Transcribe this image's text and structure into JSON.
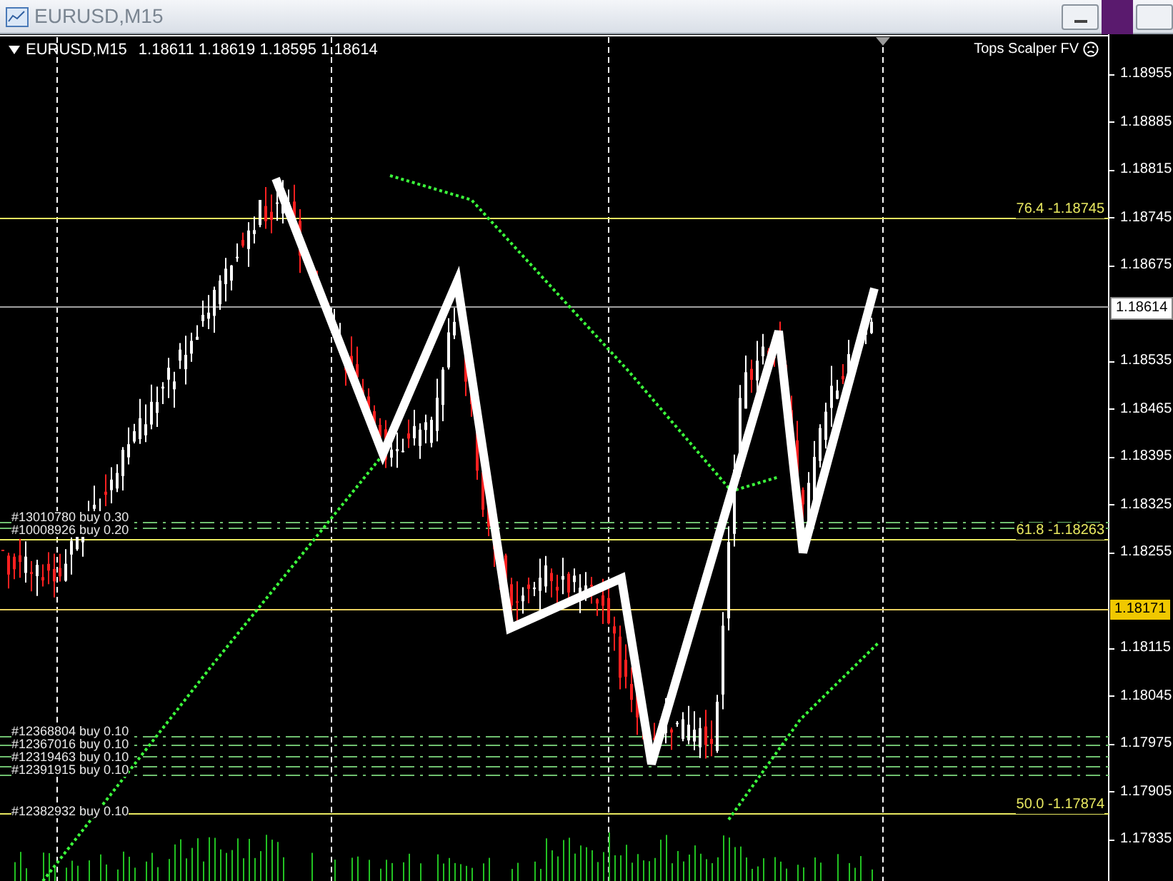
{
  "window": {
    "title": "EURUSD,M15"
  },
  "chart": {
    "symbol": "EURUSD,M15",
    "ohlc": [
      "1.18611",
      "1.18619",
      "1.18595",
      "1.18614"
    ],
    "indicator": "Tops Scalper FV",
    "price_axis": [
      "1.18955",
      "1.18885",
      "1.18815",
      "1.18745",
      "1.18675",
      "1.18535",
      "1.18465",
      "1.18395",
      "1.18325",
      "1.18255",
      "1.18115",
      "1.18045",
      "1.17975",
      "1.17905",
      "1.17835"
    ],
    "current_price": "1.18614",
    "marked_price": "1.18171",
    "fib_levels": [
      {
        "label": "76.4 -1.18745"
      },
      {
        "label": "61.8 -1.18263"
      },
      {
        "label": "50.0 -1.17874"
      }
    ],
    "orders": [
      {
        "label": "#13010780 buy 0.30"
      },
      {
        "label": "#10008926 buy 0.20"
      },
      {
        "label": "#12368804 buy 0.10"
      },
      {
        "label": "#12367016 buy 0.10"
      },
      {
        "label": "#12319463 buy 0.10"
      },
      {
        "label": "#12391915 buy 0.10"
      },
      {
        "label": "#12382932 buy 0.10"
      }
    ]
  }
}
